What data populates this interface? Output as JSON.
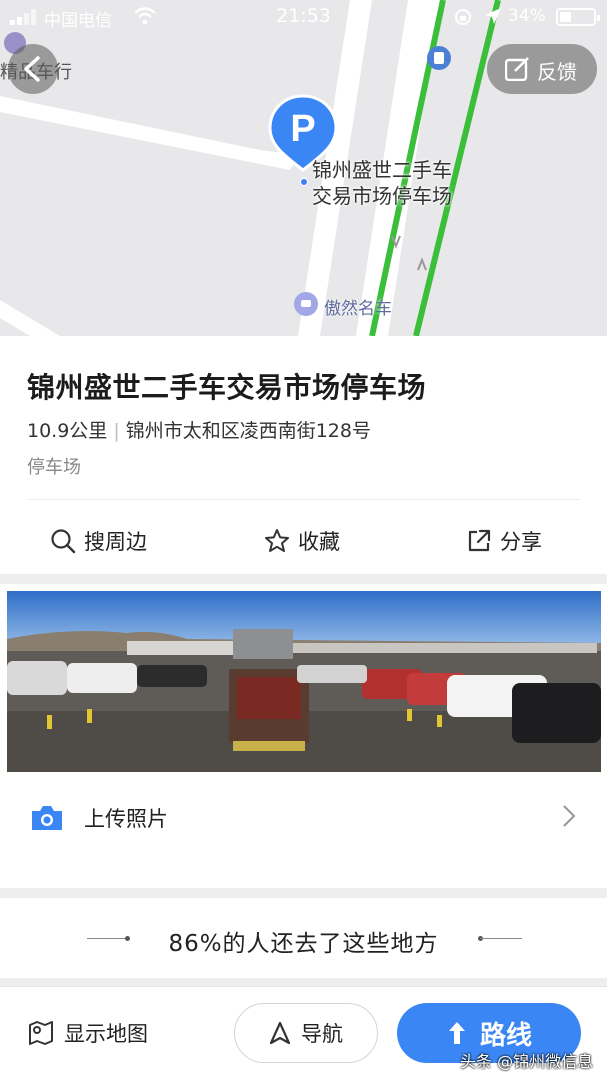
{
  "status_bar": {
    "carrier": "中国电信",
    "time": "21:53",
    "battery": "34%"
  },
  "map": {
    "feedback_label": "反馈",
    "shop_label": "精品车行",
    "poi_name_line1": "锦州盛世二手车",
    "poi_name_line2": "交易市场停车场",
    "nearby_poi_label": "傲然名车",
    "parking_icon_glyph": "P"
  },
  "place": {
    "title": "锦州盛世二手车交易市场停车场",
    "distance": "10.9公里",
    "address": "锦州市太和区凌西南街128号",
    "category": "停车场"
  },
  "actions": {
    "nearby": "搜周边",
    "favorite": "收藏",
    "share": "分享"
  },
  "photos": {
    "sign_text": "",
    "upload_label": "上传照片"
  },
  "recommend": {
    "text": "86%的人还去了这些地方"
  },
  "bottom": {
    "show_map": "显示地图",
    "navigate": "导航",
    "route": "路线"
  },
  "watermark": "头条 @锦州微信息",
  "colors": {
    "accent": "#3a86f4",
    "route_green": "#3bbf3b",
    "parking_marker": "#3a86f4"
  }
}
